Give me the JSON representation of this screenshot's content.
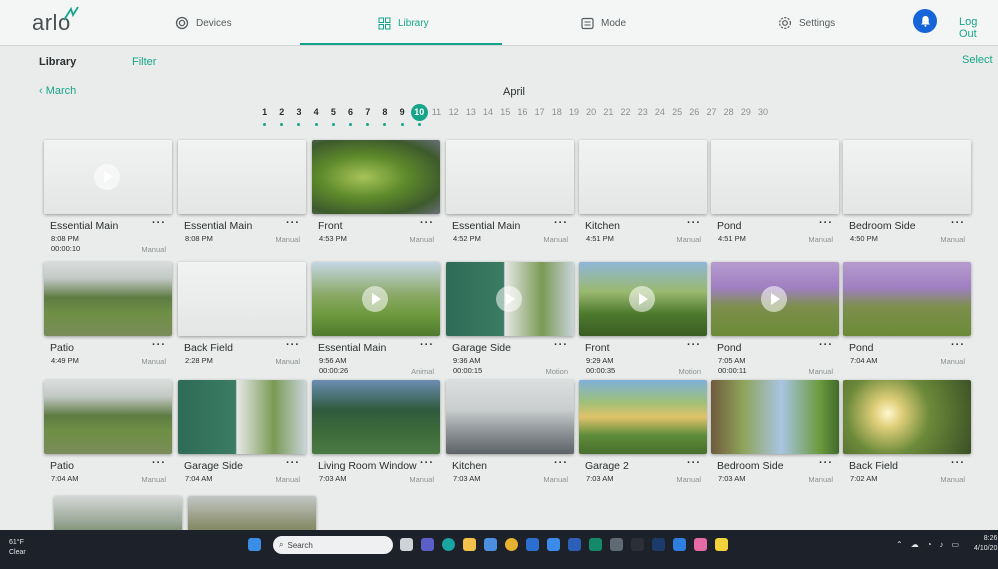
{
  "nav": {
    "logo": "arlo",
    "items": [
      {
        "label": "Devices",
        "icon": "devices-icon",
        "active": false
      },
      {
        "label": "Library",
        "icon": "library-grid-icon",
        "active": true
      },
      {
        "label": "Mode",
        "icon": "mode-icon",
        "active": false
      },
      {
        "label": "Settings",
        "icon": "gear-icon",
        "active": false
      }
    ],
    "logout": "Log Out",
    "accent": "#17a589"
  },
  "subbar": {
    "library": "Library",
    "filter": "Filter",
    "select": "Select"
  },
  "calendar": {
    "back": "March",
    "month": "April",
    "days": [
      "1",
      "2",
      "3",
      "4",
      "5",
      "6",
      "7",
      "8",
      "9",
      "10",
      "11",
      "12",
      "13",
      "14",
      "15",
      "16",
      "17",
      "18",
      "19",
      "20",
      "21",
      "22",
      "23",
      "24",
      "25",
      "26",
      "27",
      "28",
      "29",
      "30"
    ],
    "days_with_recordings": [
      "1",
      "2",
      "3",
      "4",
      "5",
      "6",
      "7",
      "8",
      "9",
      "10"
    ],
    "selected_day": "10"
  },
  "clips": [
    {
      "camera": "Essential Main",
      "time": "8:08 PM",
      "duration": "00:00:10",
      "trigger": "Manual",
      "scene": "blank",
      "play": true
    },
    {
      "camera": "Essential Main",
      "time": "8:08 PM",
      "duration": "",
      "trigger": "Manual",
      "scene": "blank",
      "play": false
    },
    {
      "camera": "Front",
      "time": "4:53 PM",
      "duration": "",
      "trigger": "Manual",
      "scene": "fish",
      "play": false
    },
    {
      "camera": "Essential Main",
      "time": "4:52 PM",
      "duration": "",
      "trigger": "Manual",
      "scene": "blank",
      "play": false
    },
    {
      "camera": "Kitchen",
      "time": "4:51 PM",
      "duration": "",
      "trigger": "Manual",
      "scene": "blank",
      "play": false
    },
    {
      "camera": "Pond",
      "time": "4:51 PM",
      "duration": "",
      "trigger": "Manual",
      "scene": "blank",
      "play": false
    },
    {
      "camera": "Bedroom Side",
      "time": "4:50 PM",
      "duration": "",
      "trigger": "Manual",
      "scene": "blank",
      "play": false
    },
    {
      "camera": "Patio",
      "time": "4:49 PM",
      "duration": "",
      "trigger": "Manual",
      "scene": "patio",
      "play": false
    },
    {
      "camera": "Back Field",
      "time": "2:28 PM",
      "duration": "",
      "trigger": "Manual",
      "scene": "blank",
      "play": false
    },
    {
      "camera": "Essential Main",
      "time": "9:56 AM",
      "duration": "00:00:26",
      "trigger": "Animal",
      "scene": "yard",
      "play": true
    },
    {
      "camera": "Garage Side",
      "time": "9:36 AM",
      "duration": "00:00:15",
      "trigger": "Motion",
      "scene": "house",
      "play": true
    },
    {
      "camera": "Front",
      "time": "9:29 AM",
      "duration": "00:00:35",
      "trigger": "Motion",
      "scene": "green",
      "play": true
    },
    {
      "camera": "Pond",
      "time": "7:05 AM",
      "duration": "00:00:11",
      "trigger": "Manual",
      "scene": "purple",
      "play": true
    },
    {
      "camera": "Pond",
      "time": "7:04 AM",
      "duration": "",
      "trigger": "Manual",
      "scene": "purple",
      "play": false
    },
    {
      "camera": "Patio",
      "time": "7:04 AM",
      "duration": "",
      "trigger": "Manual",
      "scene": "patio",
      "play": false
    },
    {
      "camera": "Garage Side",
      "time": "7:04 AM",
      "duration": "",
      "trigger": "Manual",
      "scene": "house",
      "play": false
    },
    {
      "camera": "Living Room Window",
      "time": "7:03 AM",
      "duration": "",
      "trigger": "Manual",
      "scene": "forest",
      "play": false
    },
    {
      "camera": "Kitchen",
      "time": "7:03 AM",
      "duration": "",
      "trigger": "Manual",
      "scene": "kitchen",
      "play": false
    },
    {
      "camera": "Garage 2",
      "time": "7:03 AM",
      "duration": "",
      "trigger": "Manual",
      "scene": "sunset",
      "play": false
    },
    {
      "camera": "Bedroom Side",
      "time": "7:03 AM",
      "duration": "",
      "trigger": "Manual",
      "scene": "tree",
      "play": false
    },
    {
      "camera": "Back Field",
      "time": "7:02 AM",
      "duration": "",
      "trigger": "Manual",
      "scene": "glare",
      "play": false
    },
    {
      "camera": "",
      "time": "",
      "duration": "",
      "trigger": "",
      "scene": "porch",
      "play": false
    },
    {
      "camera": "",
      "time": "",
      "duration": "",
      "trigger": "",
      "scene": "field2",
      "play": false
    }
  ],
  "taskbar": {
    "temp": "61°F",
    "condition": "Clear",
    "search_placeholder": "Search",
    "time": "8:26",
    "date": "4/10/20"
  }
}
